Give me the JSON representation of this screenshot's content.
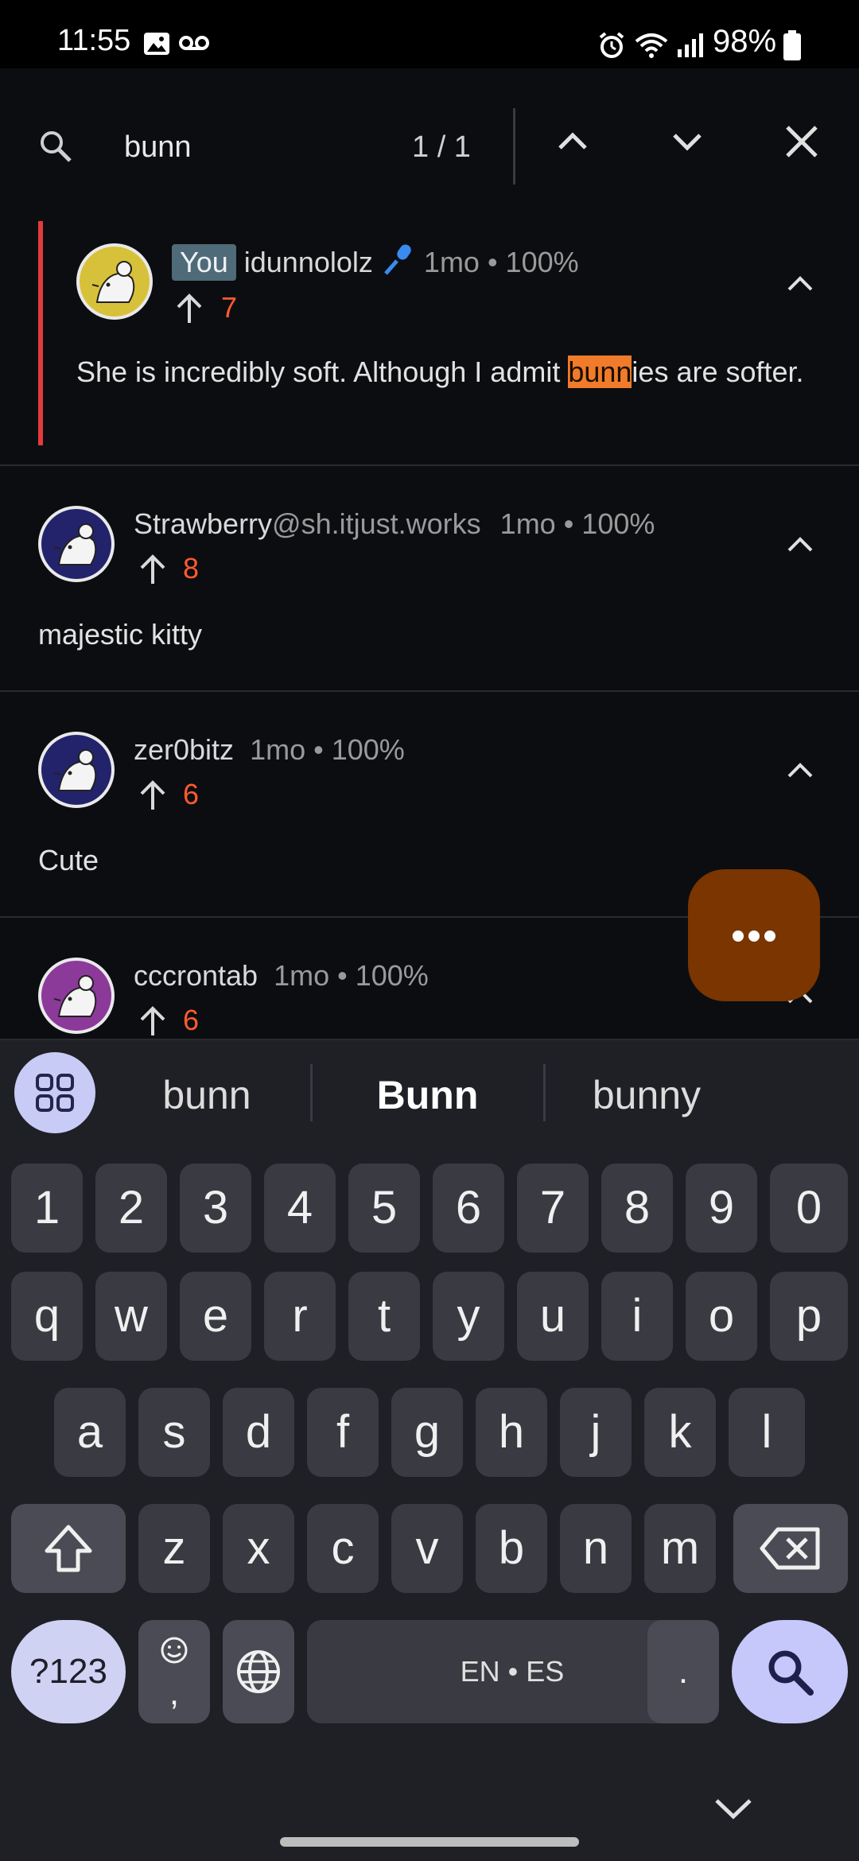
{
  "status_bar": {
    "time": "11:55",
    "battery": "98%",
    "icons": [
      "image-icon",
      "voicemail-icon",
      "alarm-icon",
      "wifi-icon",
      "signal-icon",
      "battery-icon"
    ]
  },
  "search": {
    "query": "bunn",
    "counter": "1 / 1",
    "icons": [
      "search-icon",
      "chevron-up-icon",
      "chevron-down-icon",
      "close-icon"
    ]
  },
  "comments": [
    {
      "you_badge": "You",
      "username": "idunnololz",
      "meta": "1mo • 100%",
      "score": "7",
      "body_before": "She is incredibly soft. Although I admit ",
      "body_match": "bunn",
      "body_after": "ies are softer.",
      "avatar_color": "#d8c13a"
    },
    {
      "username": "Strawberry",
      "instance": "@sh.itjust.works",
      "meta": "1mo • 100%",
      "score": "8",
      "body": "majestic kitty",
      "avatar_color": "#23236b"
    },
    {
      "username": "zer0bitz",
      "meta": "1mo • 100%",
      "score": "6",
      "body": "Cute",
      "avatar_color": "#23236b"
    },
    {
      "username": "cccrontab",
      "meta": "1mo • 100%",
      "score": "6",
      "avatar_color": "#8c3a9a"
    }
  ],
  "fab": {
    "icon": "more-horizontal-icon",
    "color": "#7a3500"
  },
  "keyboard": {
    "suggestions": [
      "bunn",
      "Bunn",
      "bunny"
    ],
    "row_numbers": [
      "1",
      "2",
      "3",
      "4",
      "5",
      "6",
      "7",
      "8",
      "9",
      "0"
    ],
    "row_1": [
      "q",
      "w",
      "e",
      "r",
      "t",
      "y",
      "u",
      "i",
      "o",
      "p"
    ],
    "row_2": [
      "a",
      "s",
      "d",
      "f",
      "g",
      "h",
      "j",
      "k",
      "l"
    ],
    "row_3": [
      "z",
      "x",
      "c",
      "v",
      "b",
      "n",
      "m"
    ],
    "symbols_key": "?123",
    "comma_key": ",",
    "space_label": "EN • ES",
    "period_key": "."
  },
  "colors": {
    "upvote": "#ff5b2e",
    "highlight": "#f07b2a",
    "selected_bar": "#e23b3b"
  }
}
